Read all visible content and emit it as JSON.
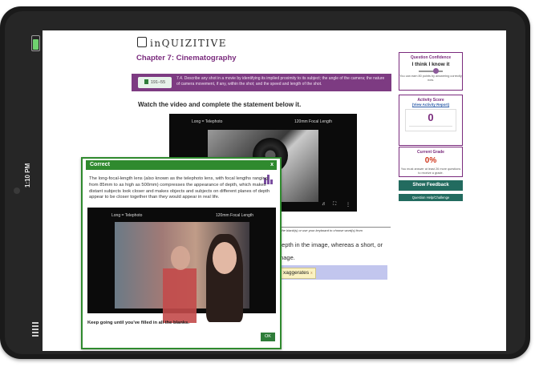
{
  "device": {
    "status_time": "1:10 PM",
    "colors": {
      "frame": "#1a1a1a",
      "battery": "#6fd16f"
    }
  },
  "app": {
    "logo": "inQUIZITIVE",
    "chapter_title": "Chapter 7: Cinematography",
    "objective": {
      "tag": "191–55",
      "text": "7.4. Describe any shot in a movie by identifying its implied proximity to its subject; the angle of the camera; the nature of camera movement, if any, within the shot; and the speed and length of the shot."
    },
    "instruction": "Watch the video and complete the statement below it.",
    "main_video": {
      "label_left": "Long = Telephoto",
      "label_right": "120mm Focal Length"
    },
    "question": {
      "hint_prefix": "n the blank(s) or use your keyboard to choose word(s) from",
      "line1": "depth in the image, whereas a short, or",
      "line2": "mage.",
      "answer_chip": "xaggerates",
      "answer_remove": "x"
    },
    "modal": {
      "title": "Correct",
      "close_label": "x",
      "text": "The long-focal-length lens (also known as the telephoto lens, with focal lengths ranging from 85mm to as high as 500mm) compresses the appearance of depth, which makes distant subjects look closer and makes objects and subjects on different planes of depth appear to be closer together than they would appear in real life.",
      "video_label_left": "Long = Telephoto",
      "video_label_right": "120mm Focal Length",
      "bottom_text": "Keep going until you've filled in all the blanks.",
      "ok_label": "OK"
    },
    "sidebar": {
      "confidence": {
        "title": "Question Confidence",
        "value": "I think I know it",
        "note": "You can earn 80 points by answering correctly now."
      },
      "activity": {
        "title": "Activity Score",
        "link": "(View Activity Report)",
        "score": "0"
      },
      "grade": {
        "title": "Current Grade",
        "value": "0%",
        "note": "You must answer at least 26 more questions to receive a grade."
      },
      "feedback_button": "Show Feedback",
      "help_button": "Question Help/Challenge"
    },
    "colors": {
      "brand_purple": "#7a2b7d",
      "correct_green": "#2f8a2e",
      "teal_button": "#226b5f",
      "grade_red": "#d0361c"
    }
  }
}
